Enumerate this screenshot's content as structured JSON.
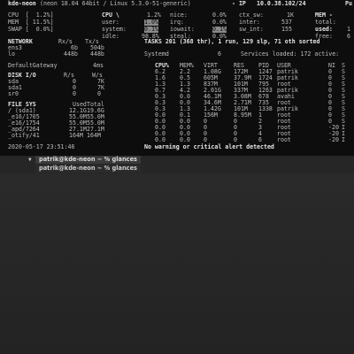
{
  "header": {
    "host": "kde-neon",
    "os": "(neon 18.04 64bit / Linux 5.3.0-51-generic)",
    "ip_label": "- IP",
    "ip": "10.0.38.102/24",
    "pub": "Pu"
  },
  "quicklook": {
    "cpu_row": "CPU  [  1.2%]",
    "mem_row": "MEM  [ 11.5%]",
    "swap_row": "SWAP [  0.0%]"
  },
  "cpu": {
    "title": "CPU \\",
    "total": "1.2%",
    "lines": [
      {
        "label": "user:",
        "value": "1.0%"
      },
      {
        "label": "system:",
        "value": "0.1%"
      },
      {
        "label": "idle:",
        "value": "98.8%"
      }
    ],
    "mid": [
      {
        "label": "nice:",
        "value": "0.0%"
      },
      {
        "label": "irq:",
        "value": "0.0%"
      },
      {
        "label": "iowait:",
        "value": "0.1%"
      },
      {
        "label": "steal:",
        "value": "0.0%"
      }
    ],
    "ctx": [
      {
        "label": "ctx_sw:",
        "value": "1K"
      },
      {
        "label": "inter:",
        "value": "537"
      },
      {
        "label": "sw_int:",
        "value": "155"
      }
    ]
  },
  "mem": {
    "title": "MEM -",
    "rows": [
      {
        "label": "total:",
        "value": ""
      },
      {
        "label": "used:",
        "value": "1"
      },
      {
        "label": "free:",
        "value": "6"
      }
    ]
  },
  "network": {
    "header": [
      "NETWORK",
      "Rx/s",
      "Tx/s"
    ],
    "rows": [
      [
        "ens3",
        "6b",
        "504b"
      ],
      [
        "lo",
        "448b",
        "448b"
      ]
    ],
    "gateway": [
      "DefaultGateway",
      "4ms"
    ]
  },
  "tasks": {
    "line": "TASKS 201 (368 thr), 1 run, 129 slp, 71 oth sorted",
    "systemd": [
      "Systemd",
      "6",
      "Services loaded: 172 active:"
    ],
    "columns": [
      "CPU%",
      "MEM%",
      "VIRT",
      "RES",
      "PID",
      "USER",
      "NI",
      "S"
    ],
    "rows": [
      [
        "6.2",
        "2.2",
        "1.08G",
        "172M",
        "1247",
        "patrik",
        "0",
        "S"
      ],
      [
        "1.6",
        "0.5",
        "605M",
        "37.9M",
        "1724",
        "patrik",
        "0",
        "S"
      ],
      [
        "1.3",
        "1.3",
        "837M",
        "101M",
        "795",
        "root",
        "0",
        "S"
      ],
      [
        "0.7",
        "4.2",
        "2.01G",
        "337M",
        "1263",
        "patrik",
        "0",
        "S"
      ],
      [
        "0.3",
        "0.0",
        "46.1M",
        "3.08M",
        "678",
        "avahi",
        "0",
        "S"
      ],
      [
        "0.3",
        "0.0",
        "34.6M",
        "2.71M",
        "735",
        "root",
        "0",
        "S"
      ],
      [
        "0.3",
        "1.3",
        "1.42G",
        "101M",
        "1338",
        "patrik",
        "0",
        "S"
      ],
      [
        "0.0",
        "0.1",
        "156M",
        "8.95M",
        "1",
        "root",
        "0",
        "S"
      ],
      [
        "0.0",
        "0.0",
        "0",
        "0",
        "2",
        "root",
        "0",
        "S"
      ],
      [
        "0.0",
        "0.0",
        "0",
        "0",
        "3",
        "root",
        "-20",
        "I"
      ],
      [
        "0.0",
        "0.0",
        "0",
        "0",
        "4",
        "root",
        "-20",
        "I"
      ],
      [
        "0.0",
        "0.0",
        "0",
        "0",
        "6",
        "root",
        "-20",
        "I"
      ]
    ]
  },
  "disk": {
    "header": [
      "DISK I/O",
      "R/s",
      "W/s"
    ],
    "rows": [
      [
        "sda",
        "0",
        "7K"
      ],
      [
        "sda1",
        "0",
        "7K"
      ],
      [
        "sr0",
        "0",
        "0"
      ]
    ]
  },
  "fs": {
    "header": [
      "FILE SYS",
      "Used",
      "Total"
    ],
    "rows": [
      [
        "/ (sda1)",
        "12.1G",
        "19.6G"
      ],
      [
        "_e16/1705",
        "55.0M",
        "55.0M"
      ],
      [
        "_e16/1754",
        "55.0M",
        "55.0M"
      ],
      [
        "_apd/7264",
        "27.1M",
        "27.1M"
      ],
      [
        "_otify/41",
        "164M",
        "164M"
      ]
    ]
  },
  "footer": {
    "datetime": "2020-05-17 23:51:46",
    "alert": "No warning or critical alert detected"
  },
  "tabs": [
    {
      "label": "patrik@kde-neon ~ % glances"
    },
    {
      "label": "patrik@kde-neon ~ % glances"
    }
  ],
  "icons": {
    "tab_chevron": "chevron-down-icon"
  }
}
